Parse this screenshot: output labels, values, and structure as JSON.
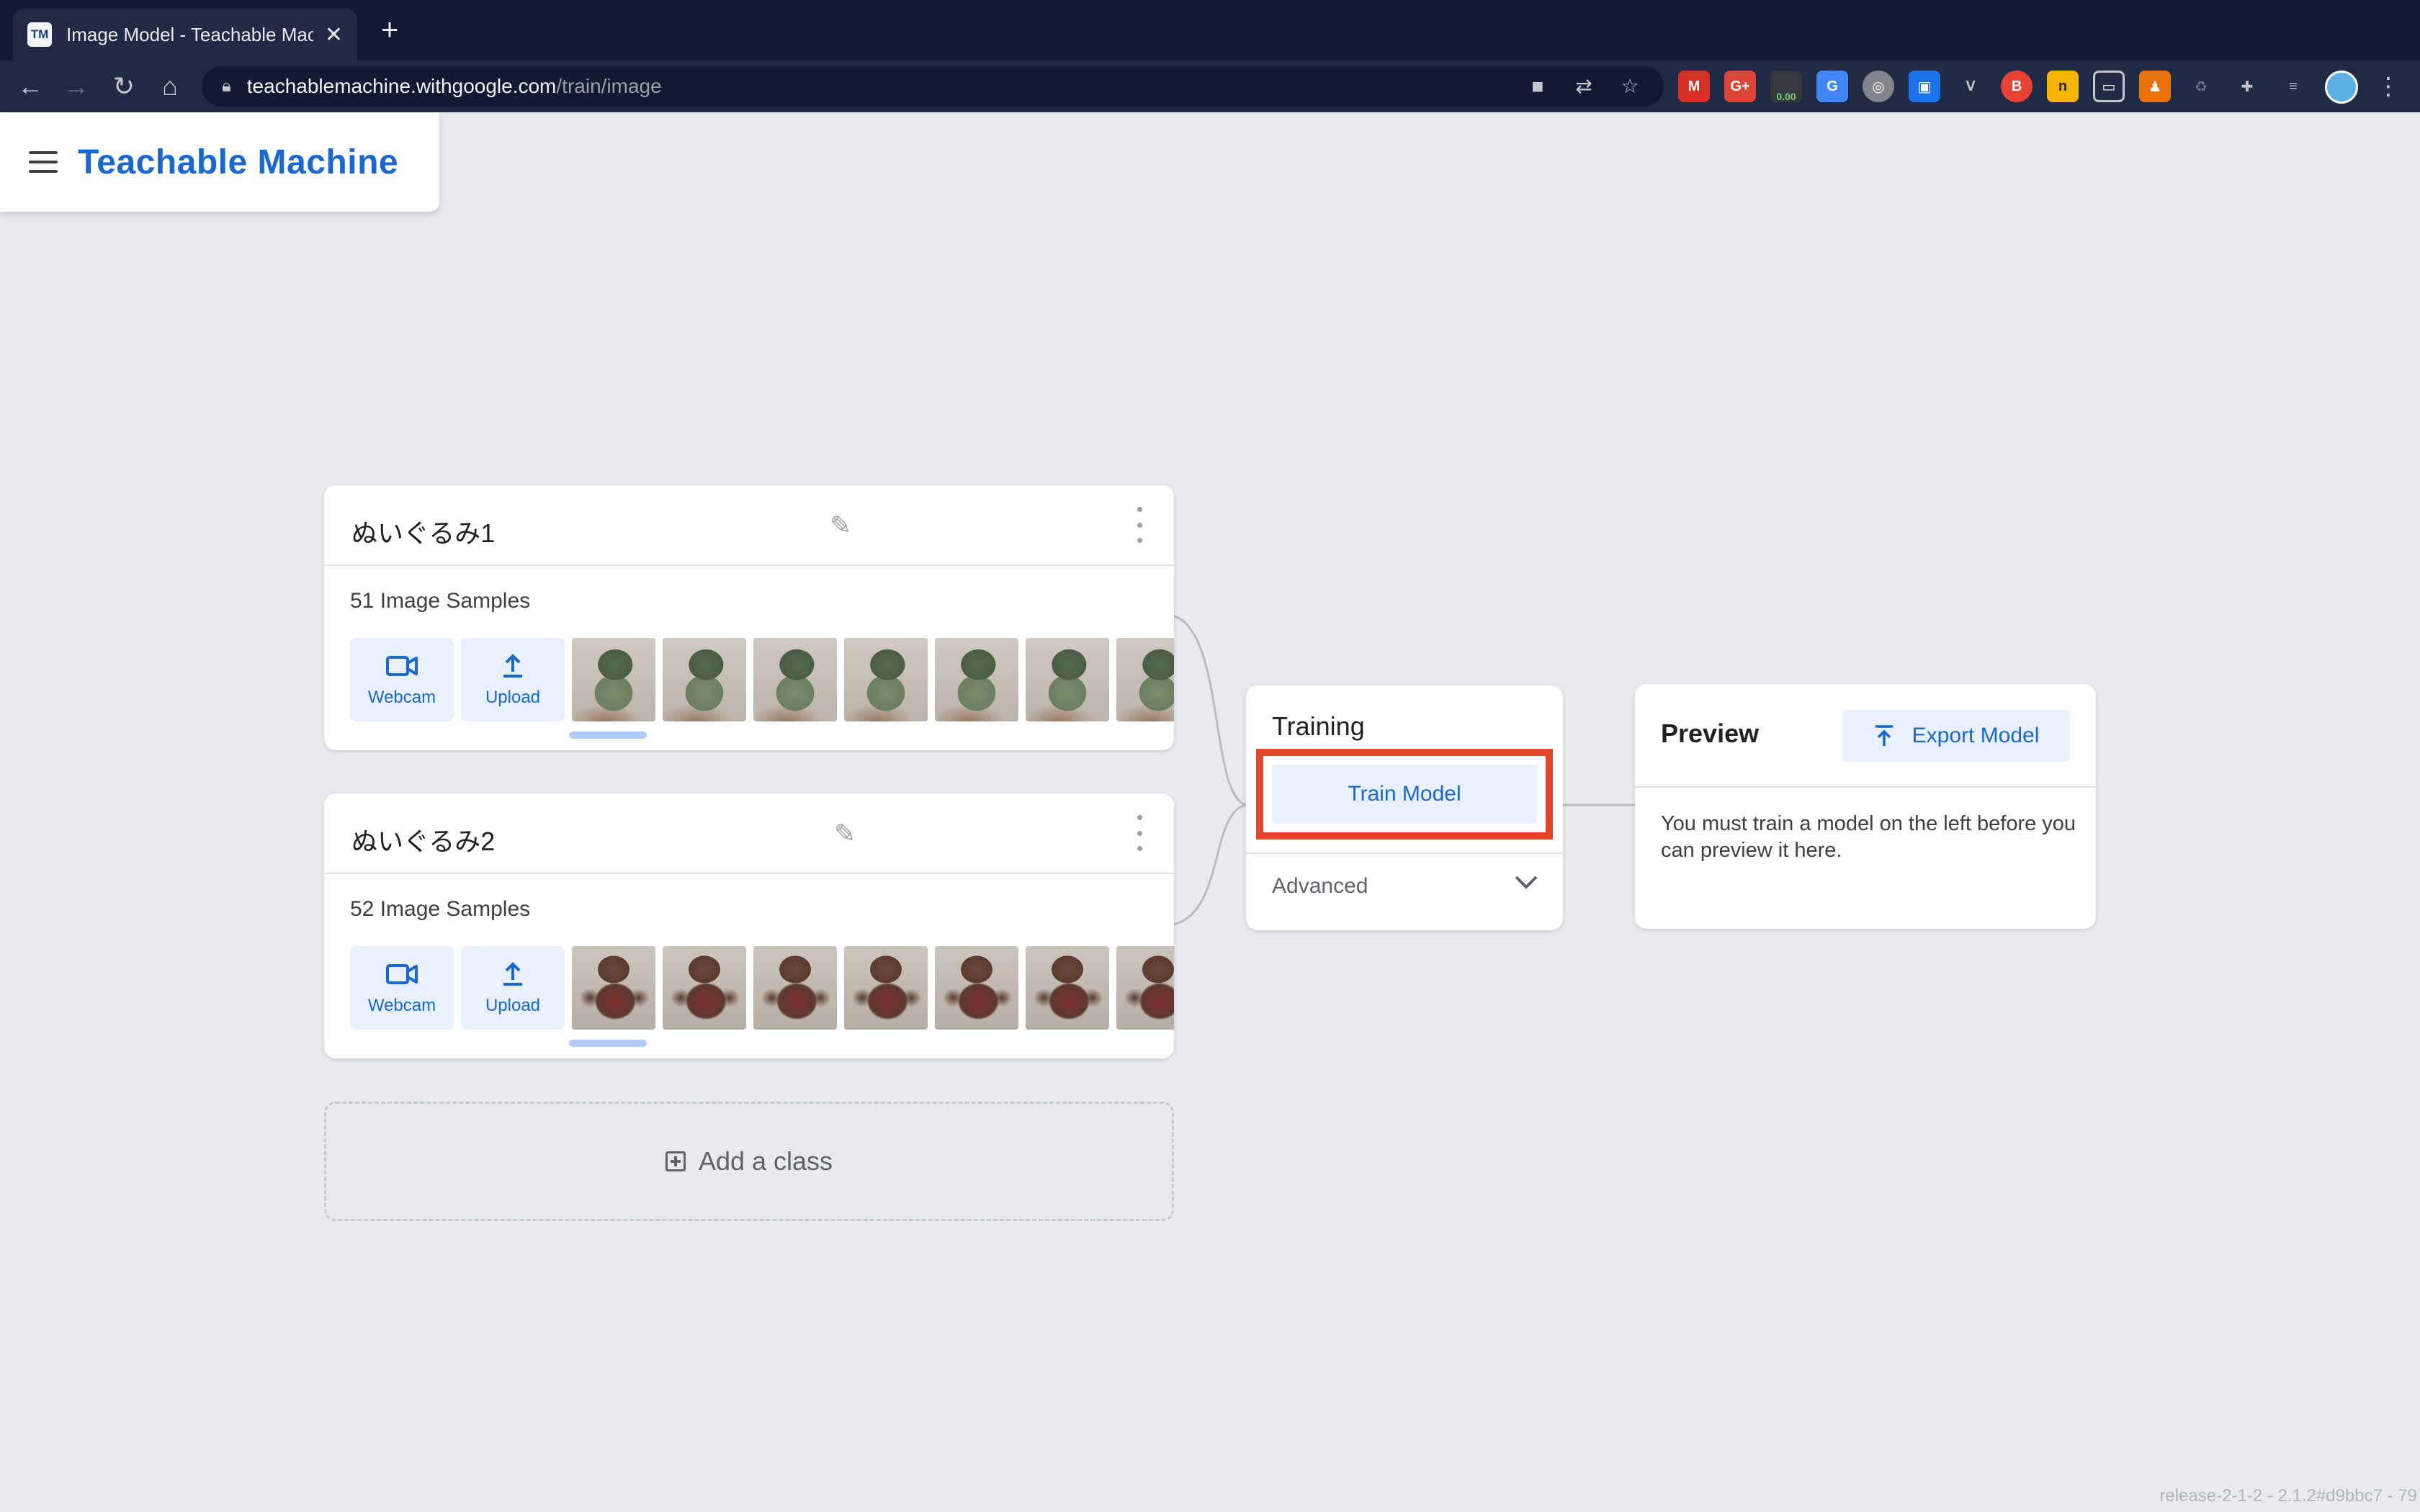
{
  "browser": {
    "tab_title": "Image Model - Teachable Machine",
    "tab_favicon": "TM",
    "url_host": "teachablemachine.withgoogle.com",
    "url_path": "/train/image",
    "extension_badge": "0.00"
  },
  "app": {
    "logo": "Teachable Machine"
  },
  "classes": [
    {
      "name": "ぬいぐるみ1",
      "samples_label": "51 Image Samples",
      "webcam_label": "Webcam",
      "upload_label": "Upload"
    },
    {
      "name": "ぬいぐるみ2",
      "samples_label": "52 Image Samples",
      "webcam_label": "Webcam",
      "upload_label": "Upload"
    }
  ],
  "add_class_label": "Add a class",
  "training": {
    "title": "Training",
    "train_button": "Train Model",
    "advanced_label": "Advanced"
  },
  "preview": {
    "title": "Preview",
    "export_button": "Export Model",
    "message": "You must train a model on the left before you can preview it here."
  },
  "footer": {
    "version": "release-2-1-2 - 2.1.2#d9bbc7 - 79"
  },
  "colors": {
    "accent": "#1967d2",
    "highlight": "#e2452a",
    "button_bg": "#e8f0fe"
  }
}
